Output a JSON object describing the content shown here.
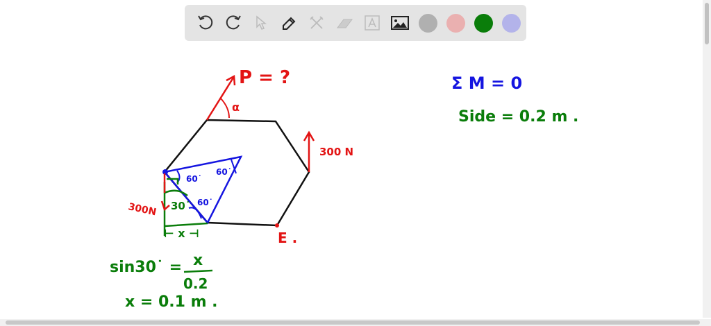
{
  "toolbar": {
    "tools": [
      "undo-icon",
      "redo-icon",
      "select-icon",
      "pen-icon",
      "tools-icon",
      "eraser-icon",
      "text-icon",
      "image-icon"
    ],
    "colors": [
      "#b0b0b0",
      "#eab0b0",
      "#0a7d0a",
      "#b3b3ea"
    ]
  },
  "board": {
    "p_label": "P = ?",
    "alpha_label": "α",
    "force_right_label": "300 N",
    "force_left_label": "300N",
    "e_label": "E .",
    "angle_60a": "60˙",
    "angle_60b": "60˙",
    "angle_60c": "60˙",
    "angle_30": "30˙",
    "x_dim": "⊢ x ⊣",
    "sum_m": "Σ M = 0",
    "side": "Side = 0.2 m .",
    "eq1_left": "sin30˙ =",
    "eq1_num": "x",
    "eq1_den": "0.2",
    "eq2": "x = 0.1 m ."
  }
}
